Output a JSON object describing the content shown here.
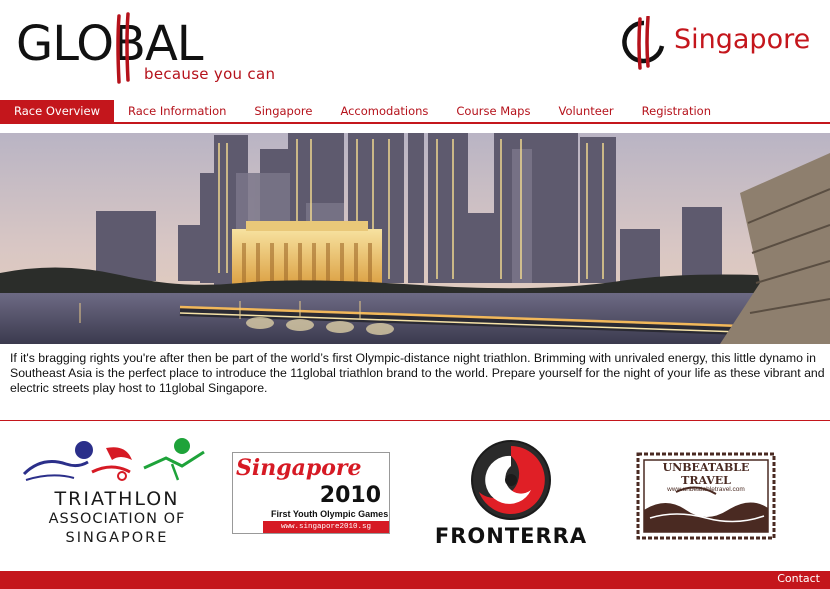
{
  "header": {
    "brand": "GLOBAL",
    "tagline": "because you can",
    "city": "Singapore"
  },
  "nav": {
    "items": [
      {
        "label": "Race Overview",
        "active": true
      },
      {
        "label": "Race Information"
      },
      {
        "label": "Singapore"
      },
      {
        "label": "Accomodations"
      },
      {
        "label": "Course Maps"
      },
      {
        "label": "Volunteer"
      },
      {
        "label": "Registration"
      }
    ]
  },
  "intro": {
    "text": "If it's bragging rights you're after then be part of the world’s first Olympic-distance night triathlon. Brimming with unrivaled energy, this little dynamo in Southeast Asia is the perfect place to introduce the 11global triathlon brand to the world. Prepare yourself for the night of your life as these vibrant and electric streets play host to 11global Singapore."
  },
  "sponsors": {
    "tas": {
      "line1": "TRIATHLON",
      "line2": "ASSOCIATION OF",
      "line3": "SINGAPORE"
    },
    "sg2010": {
      "title": "Singapore",
      "year": "2010",
      "subtitle": "First Youth Olympic Games",
      "url": "www.singapore2010.sg"
    },
    "fronterra": {
      "name": "FRONTERRA"
    },
    "unbeatable": {
      "title": "UNBEATABLE TRAVEL",
      "url": "www.unbeatabletravel.com"
    }
  },
  "footer": {
    "contact": "Contact"
  },
  "colors": {
    "brand_red": "#c4161c",
    "text": "#111111"
  }
}
